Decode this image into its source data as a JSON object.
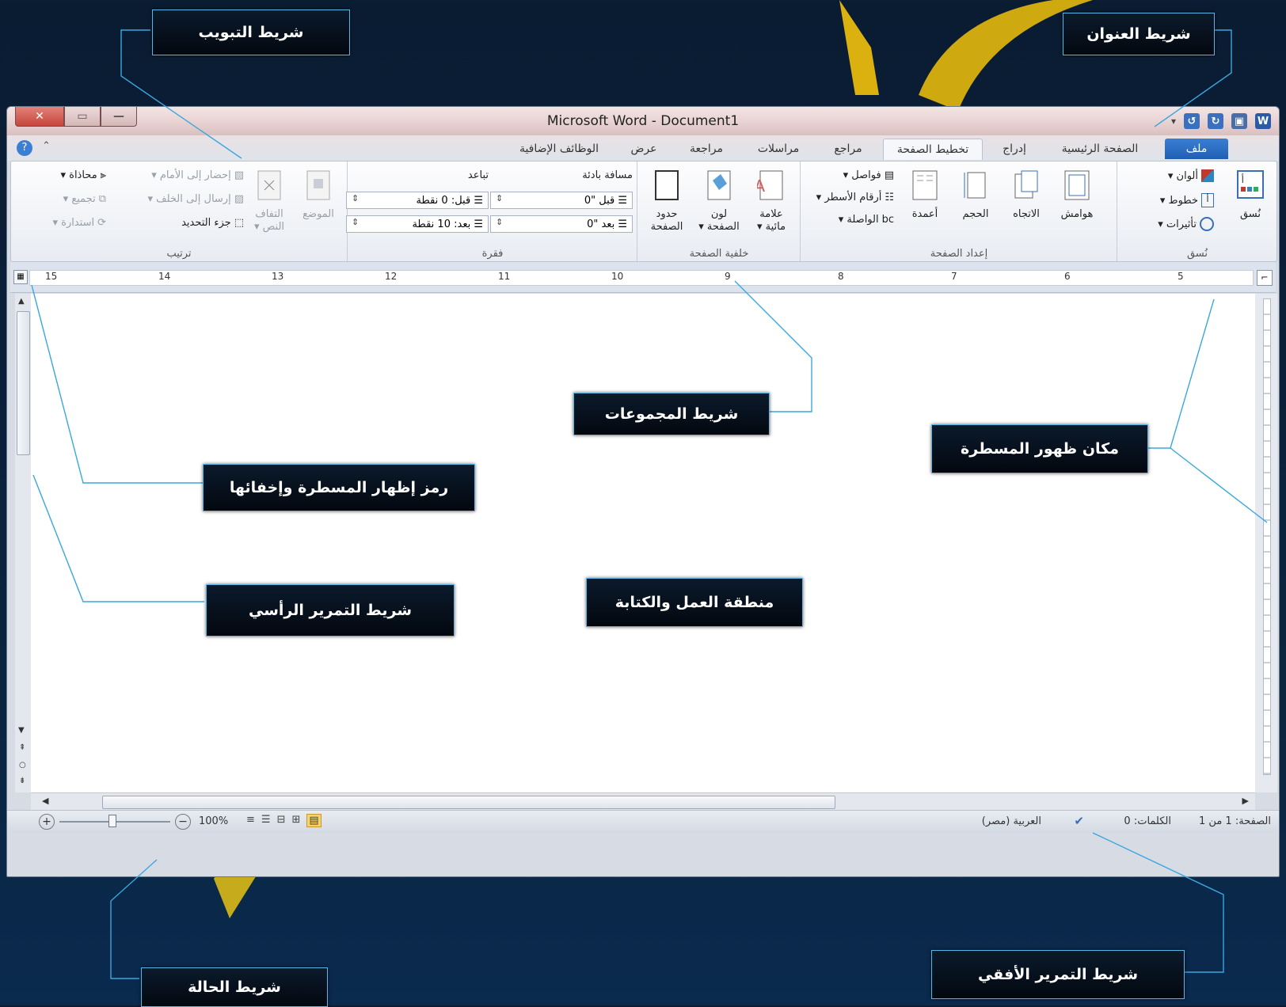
{
  "window": {
    "title": "Microsoft Word - Document1",
    "title_bar_color": "#e8d2d1",
    "close_glyph": "✕",
    "restore_glyph": "▭",
    "minimize_glyph": "—"
  },
  "quick_access": {
    "icons": [
      "word-logo-icon",
      "save-icon",
      "redo-icon",
      "undo-icon",
      "customize-icon"
    ],
    "word_letter": "W"
  },
  "tabs": {
    "file": "ملف",
    "home": "الصفحة الرئيسية",
    "insert": "إدراج",
    "page_layout": "تخطيط الصفحة",
    "references": "مراجع",
    "mailings": "مراسلات",
    "review": "مراجعة",
    "view": "عرض",
    "addins": "الوظائف الإضافية"
  },
  "ribbon": {
    "themes": {
      "label": "نُسق",
      "themes_btn": "نُسق",
      "colors": "ألوان ▾",
      "fonts": "خطوط ▾",
      "effects": "تأثيرات ▾"
    },
    "page_setup": {
      "label": "إعداد الصفحة",
      "margins": "هوامش",
      "orientation": "الاتجاه",
      "size": "الحجم",
      "columns": "أعمدة",
      "breaks": "فواصل ▾",
      "line_numbers": "أرقام الأسطر ▾",
      "hyphenation": "الواصلة ▾",
      "hyphen_glyph": "bc"
    },
    "page_background": {
      "label": "خلفية الصفحة",
      "watermark_1": "علامة",
      "watermark_2": "مائية ▾",
      "page_color_1": "لون",
      "page_color_2": "الصفحة ▾",
      "page_borders_1": "حدود",
      "page_borders_2": "الصفحة"
    },
    "paragraph": {
      "label": "فقرة",
      "indent_title": "مسافة بادئة",
      "spacing_title": "تباعد",
      "indent_before_label": "قبل",
      "indent_before_value": "\"0",
      "indent_after_label": "بعد",
      "indent_after_value": "\"0",
      "spacing_before_label": "قبل:",
      "spacing_before_value": "0 نقطة",
      "spacing_after_label": "بعد:",
      "spacing_after_value": "10 نقطة"
    },
    "arrange": {
      "label": "ترتيب",
      "position": "الموضع",
      "wrap_text_1": "التفاف",
      "wrap_text_2": "النص ▾",
      "bring_forward": "إحضار إلى الأمام ▾",
      "send_backward": "إرسال إلى الخلف ▾",
      "selection_pane": "جزء التحديد",
      "align": "محاذاة ▾",
      "group": "تجميع ▾",
      "rotate": "استدارة ▾"
    }
  },
  "ruler": {
    "numbers": [
      "15",
      "14",
      "13",
      "12",
      "11",
      "10",
      "9",
      "8",
      "7",
      "6",
      "5"
    ]
  },
  "status_bar": {
    "page": "الصفحة: 1 من 1",
    "words": "الكلمات: 0",
    "language": "العربية (مصر)",
    "zoom": "100%"
  },
  "callouts": {
    "tab_bar": "شريط التبويب",
    "title_bar": "شريط العنوان",
    "groups_bar": "شريط المجموعات",
    "ruler_place": "مكان ظهور المسطرة",
    "ruler_toggle": "رمز إظهار المسطرة وإخفائها",
    "vertical_scrollbar": "شريط التمرير الرأسي",
    "work_area": "منطقة العمل والكتابة",
    "status_bar": "شريط الحالة",
    "horizontal_scrollbar": "شريط التمرير الأفقي"
  },
  "colors": {
    "background": "#0b2440",
    "callout_border": "#58b6e6",
    "file_tab": "#2a6ec6",
    "watermark_yellow": "#f2c20b"
  }
}
